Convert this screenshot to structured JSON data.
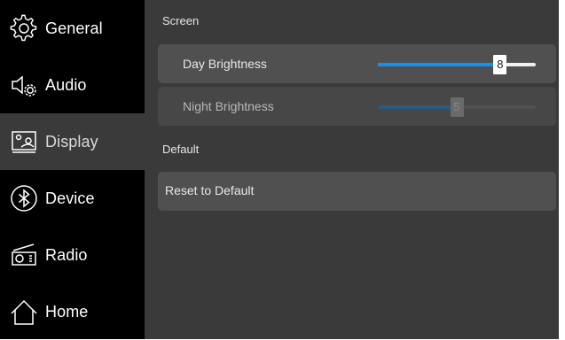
{
  "sidebar": {
    "items": [
      {
        "label": "General",
        "icon": "gear-icon"
      },
      {
        "label": "Audio",
        "icon": "speaker-gear-icon"
      },
      {
        "label": "Display",
        "icon": "display-icon",
        "active": true
      },
      {
        "label": "Device",
        "icon": "bluetooth-icon"
      },
      {
        "label": "Radio",
        "icon": "radio-icon"
      },
      {
        "label": "Home",
        "icon": "home-icon"
      }
    ]
  },
  "main": {
    "screen_section_title": "Screen",
    "day_brightness": {
      "label": "Day Brightness",
      "value": 8,
      "max": 10
    },
    "night_brightness": {
      "label": "Night Brightness",
      "value": 5,
      "max": 10,
      "enabled": false
    },
    "default_section_title": "Default",
    "reset_label": "Reset to Default"
  },
  "colors": {
    "sidebar_bg": "#000000",
    "content_bg": "#3a3a3a",
    "row_bg": "#505050",
    "accent": "#1a8fe8"
  }
}
